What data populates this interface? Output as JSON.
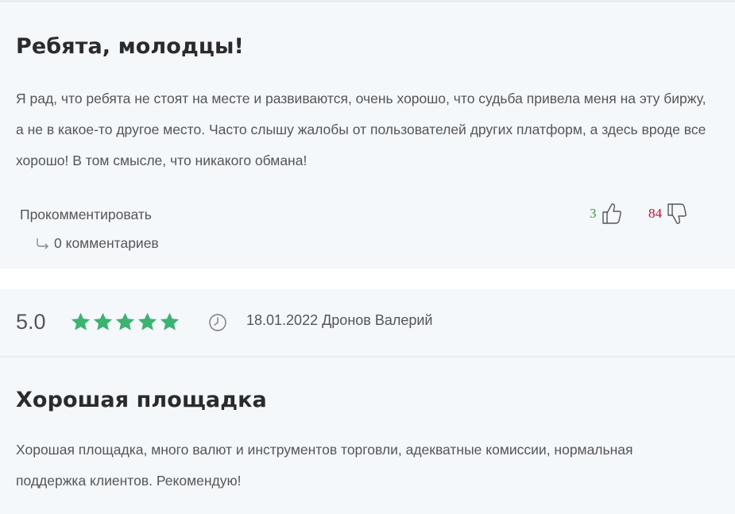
{
  "reviews": [
    {
      "title": "Ребята, молодцы!",
      "text": "Я рад, что ребята не стоят на месте и развиваются, очень хорошо, что судьба привела меня на эту биржу, а не в какое-то другое место. Часто слышу жалобы от пользователей других платформ, а здесь вроде все хорошо! В том смысле, что никакого обмана!",
      "comment_label": "Прокомментировать",
      "comments_count_label": "0 комментариев",
      "likes": "3",
      "dislikes": "84"
    },
    {
      "rating": "5.0",
      "stars": 5,
      "date": "18.01.2022",
      "author": "Дронов Валерий",
      "title": "Хорошая площадка",
      "text": "Хорошая площадка, много валют и инструментов торговли, адекватные комиссии, нормальная поддержка клиентов. Рекомендую!"
    }
  ],
  "icons": {
    "like": "thumbs-up-icon",
    "dislike": "thumbs-down-icon",
    "reply": "reply-arrow-icon",
    "clock": "clock-icon",
    "star": "star-icon"
  },
  "colors": {
    "card_bg": "#f5f8fb",
    "star": "#3cb371",
    "likes": "#2ca02c",
    "dislikes": "#c8102e",
    "title": "#2b2b2b",
    "text": "#555555"
  }
}
